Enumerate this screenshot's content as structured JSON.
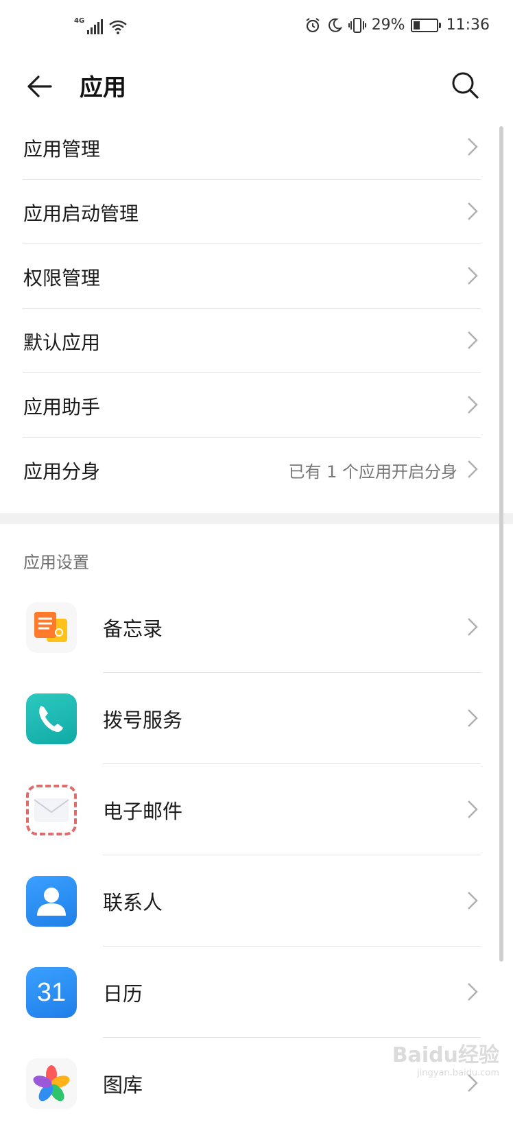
{
  "status_bar": {
    "network": "4G",
    "battery_percent": "29%",
    "time": "11:36"
  },
  "header": {
    "title": "应用"
  },
  "menu": [
    {
      "label": "应用管理",
      "value": ""
    },
    {
      "label": "应用启动管理",
      "value": ""
    },
    {
      "label": "权限管理",
      "value": ""
    },
    {
      "label": "默认应用",
      "value": ""
    },
    {
      "label": "应用助手",
      "value": ""
    },
    {
      "label": "应用分身",
      "value": "已有 1 个应用开启分身"
    }
  ],
  "section_title": "应用设置",
  "apps": [
    {
      "label": "备忘录",
      "icon": "notepad-icon"
    },
    {
      "label": "拨号服务",
      "icon": "phone-icon"
    },
    {
      "label": "电子邮件",
      "icon": "email-icon"
    },
    {
      "label": "联系人",
      "icon": "contacts-icon"
    },
    {
      "label": "日历",
      "icon": "calendar-icon",
      "icon_text": "31"
    },
    {
      "label": "图库",
      "icon": "gallery-icon"
    }
  ],
  "watermark": {
    "brand": "Baidu经验",
    "url": "jingyan.baidu.com"
  },
  "colors": {
    "accent_teal": "#1bb8b0",
    "accent_blue": "#2f8ef0",
    "notepad_orange": "#ff7a2a"
  }
}
